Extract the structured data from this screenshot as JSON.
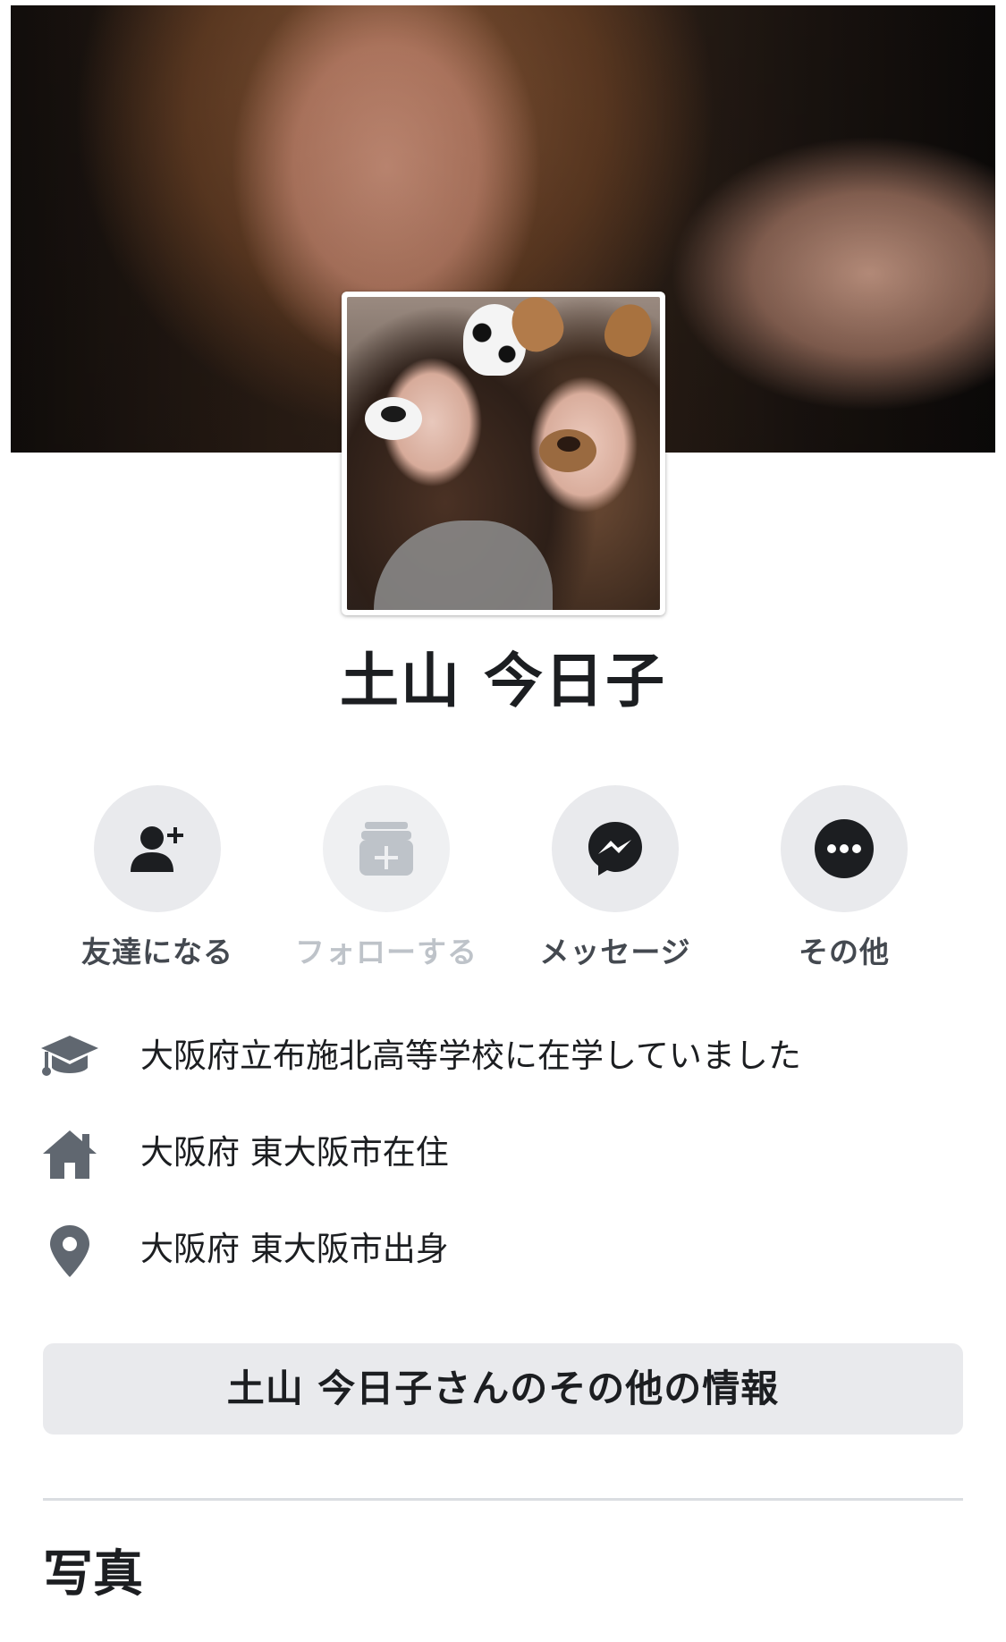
{
  "profile": {
    "name": "土山 今日子"
  },
  "actions": [
    {
      "label": "友達になる",
      "icon": "add-friend-icon",
      "enabled": true
    },
    {
      "label": "フォローする",
      "icon": "follow-icon",
      "enabled": false
    },
    {
      "label": "メッセージ",
      "icon": "messenger-icon",
      "enabled": true
    },
    {
      "label": "その他",
      "icon": "more-icon",
      "enabled": true
    }
  ],
  "intro": [
    {
      "icon": "graduation-cap-icon",
      "text": "大阪府立布施北高等学校に在学していました"
    },
    {
      "icon": "home-icon",
      "text": "大阪府 東大阪市在住"
    },
    {
      "icon": "location-pin-icon",
      "text": "大阪府 東大阪市出身"
    }
  ],
  "more_info_button": "土山 今日子さんのその他の情報",
  "photos_heading": "写真",
  "colors": {
    "button_bg": "#e9eaed",
    "icon_dark": "#1c1e21",
    "icon_gray": "#606770",
    "disabled": "#bec3c9"
  }
}
